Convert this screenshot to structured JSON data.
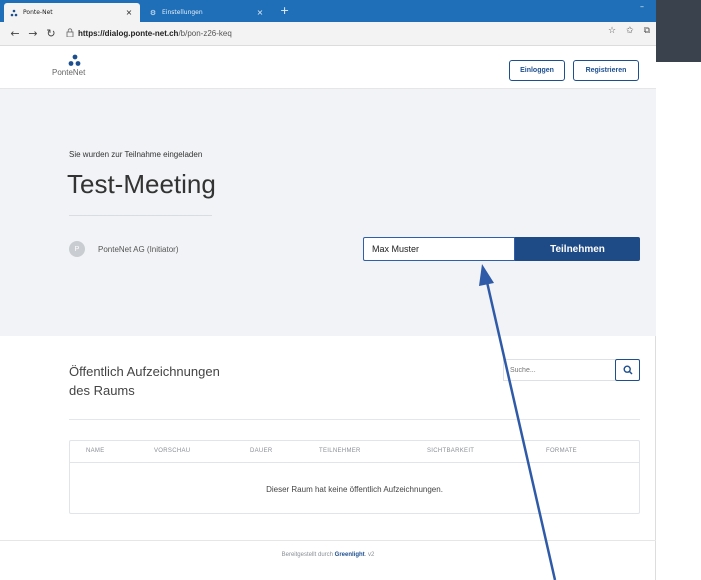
{
  "browser": {
    "tabs": [
      {
        "title": "Ponte-Net",
        "icon": "ponte-net-favicon",
        "close": "×"
      },
      {
        "title": "Einstellungen",
        "icon": "gear-icon",
        "close": "×"
      }
    ],
    "new_tab": "+",
    "window_minimize": "–",
    "url_domain": "https://dialog.ponte-net.ch",
    "url_path": "/b/pon-z26-keq",
    "nav": {
      "back": "←",
      "forward": "→",
      "reload": "↻"
    },
    "actions": {
      "favorite": "☆",
      "favorites_bar": "✩",
      "collections": "⧉"
    }
  },
  "header": {
    "logo_text": "PonteNet",
    "login_label": "Einloggen",
    "register_label": "Registrieren"
  },
  "hero": {
    "invite_text": "Sie wurden zur Teilnahme eingeladen",
    "meeting_title": "Test-Meeting",
    "owner_initial": "P",
    "owner_name": "PonteNet AG (Initiator)",
    "name_value": "Max Muster",
    "join_label": "Teilnehmen"
  },
  "recordings": {
    "title_line1": "Öffentlich Aufzeichnungen",
    "title_line2": "des Raums",
    "search_placeholder": "Suche...",
    "columns": [
      "NAME",
      "VORSCHAU",
      "DAUER",
      "TEILNEHMER",
      "SICHTBARKEIT",
      "FORMATE"
    ],
    "empty_message": "Dieser Raum hat keine öffentlich Aufzeichnungen."
  },
  "footer": {
    "prefix": "Bereitgestellt durch",
    "link": "Greenlight",
    "suffix": ". v2"
  },
  "colors": {
    "browser_blue": "#1f6fb8",
    "primary": "#1e4a86",
    "hero_bg": "#f1f3f6",
    "annotation_arrow": "#2f5aa8"
  }
}
